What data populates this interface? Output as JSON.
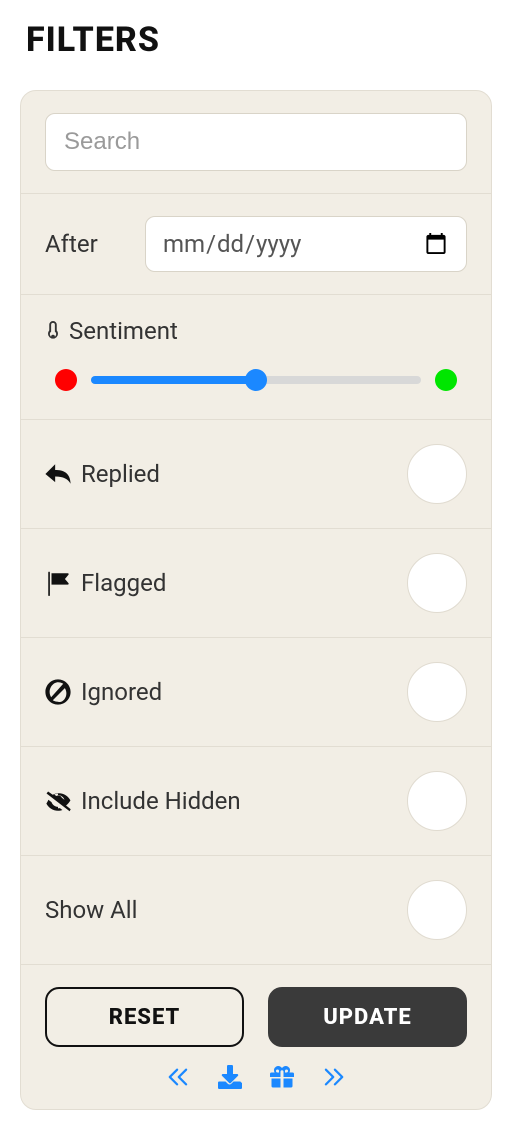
{
  "title": "FILTERS",
  "search": {
    "placeholder": "Search"
  },
  "date": {
    "label": "After",
    "placeholder": "mm/dd/yyyy"
  },
  "sentiment": {
    "label": "Sentiment",
    "value": 50,
    "min": 0,
    "max": 100,
    "low_color": "#ff0000",
    "high_color": "#00e600"
  },
  "toggles": {
    "replied": "Replied",
    "flagged": "Flagged",
    "ignored": "Ignored",
    "hidden": "Include Hidden",
    "all": "Show All"
  },
  "buttons": {
    "reset": "RESET",
    "update": "UPDATE"
  }
}
